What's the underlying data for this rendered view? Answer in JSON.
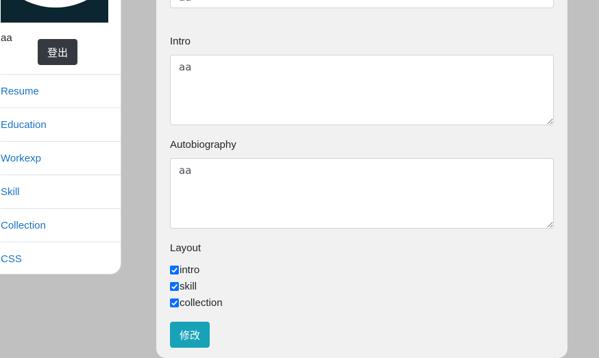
{
  "sidebar": {
    "user_name": "aa",
    "logout_label": "登出",
    "items": [
      {
        "label": "Resume"
      },
      {
        "label": "Education"
      },
      {
        "label": "Workexp"
      },
      {
        "label": "Skill"
      },
      {
        "label": "Collection"
      },
      {
        "label": "CSS"
      }
    ]
  },
  "form": {
    "top_field_value": "aa",
    "intro": {
      "label": "Intro",
      "value": "aa"
    },
    "autobiography": {
      "label": "Autobiography",
      "value": "aa"
    },
    "layout": {
      "label": "Layout",
      "options": [
        {
          "label": "intro",
          "checked": true
        },
        {
          "label": "skill",
          "checked": true
        },
        {
          "label": "collection",
          "checked": true
        }
      ]
    },
    "submit_label": "修改"
  },
  "colors": {
    "background": "#c0c0c0",
    "link": "#1a73c6",
    "logout_button": "#343a40",
    "submit_button": "#17a2b8",
    "checkbox": "#0d6efd",
    "avatar_bg": "#0b2630"
  }
}
